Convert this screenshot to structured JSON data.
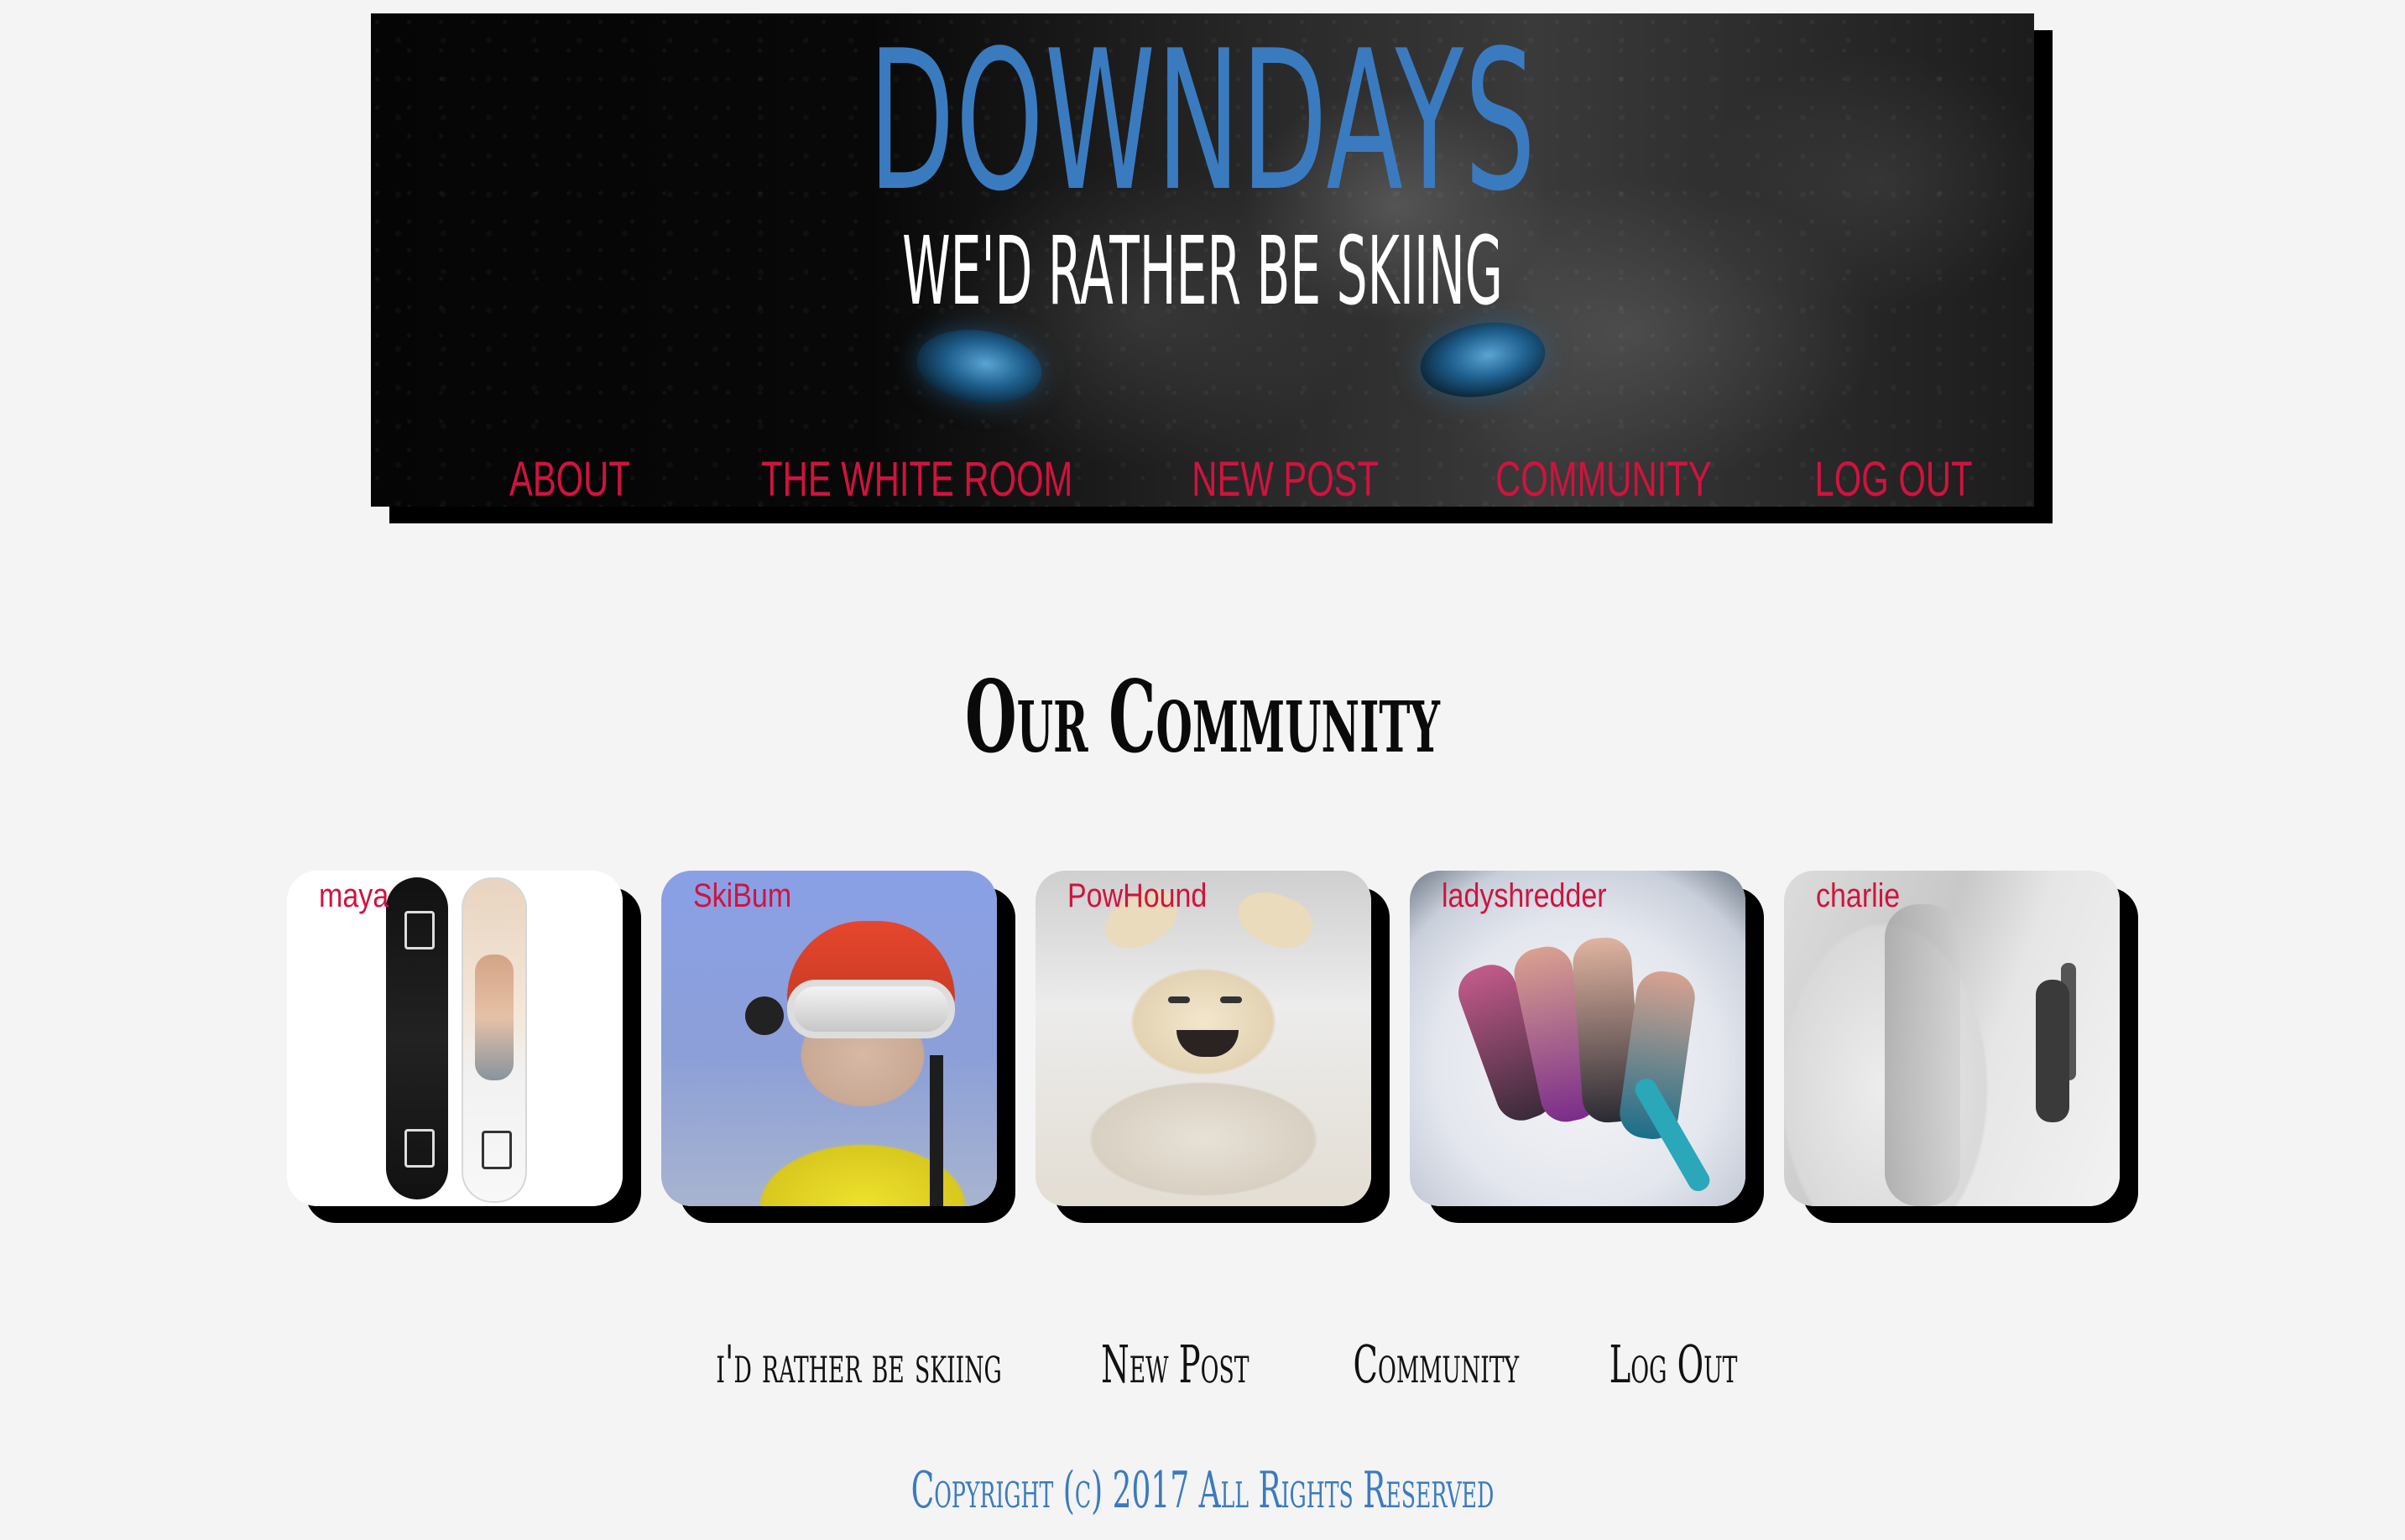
{
  "header": {
    "site_title": "DOWNDAYS",
    "tagline": "WE'D RATHER BE SKIING",
    "nav": [
      {
        "label": "ABOUT"
      },
      {
        "label": "THE WHITE ROOM"
      },
      {
        "label": "NEW POST"
      },
      {
        "label": "COMMUNITY"
      },
      {
        "label": "LOG OUT"
      }
    ]
  },
  "main": {
    "heading": "Our Community",
    "members": [
      {
        "username": "maya"
      },
      {
        "username": "SkiBum"
      },
      {
        "username": "PowHound"
      },
      {
        "username": "ladyshredder"
      },
      {
        "username": "charlie"
      }
    ]
  },
  "footer": {
    "nav": [
      {
        "label": "i'd rather be skiing"
      },
      {
        "label": "New Post"
      },
      {
        "label": "Community"
      },
      {
        "label": "Log Out"
      }
    ],
    "copyright": "Copyright (c) 2017 All Rights Reserved"
  },
  "colors": {
    "accent_red": "#d0133e",
    "brand_blue": "#3a7bc0",
    "page_background": "#f4f4f4"
  }
}
